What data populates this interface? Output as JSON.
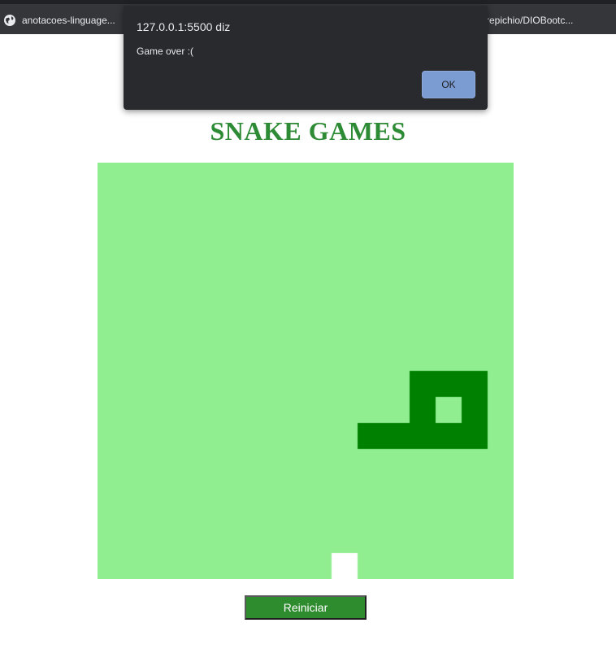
{
  "browser": {
    "bookmarks": [
      {
        "label": "anotacoes-linguage...",
        "icon": "globe-icon"
      },
      {
        "label": "repichio/DIOBootc..."
      }
    ]
  },
  "page": {
    "title": "SNAKE GAMES",
    "restart_label": "Reiniciar"
  },
  "game": {
    "grid_size": 16,
    "board_color": "#90ee90",
    "snake_color": "#008000",
    "food_color": "#ffffff",
    "snake_cells": [
      [
        12,
        8
      ],
      [
        13,
        8
      ],
      [
        14,
        8
      ],
      [
        12,
        9
      ],
      [
        14,
        9
      ],
      [
        10,
        10
      ],
      [
        11,
        10
      ],
      [
        12,
        10
      ],
      [
        13,
        10
      ],
      [
        14,
        10
      ]
    ],
    "food_cell": [
      9,
      15
    ]
  },
  "alert": {
    "origin": "127.0.0.1:5500 diz",
    "message": "Game over :(",
    "ok_label": "OK"
  },
  "colors": {
    "title": "#2e8b35",
    "button": "#2e8b2e",
    "dialog_bg": "#292a2d",
    "ok_button": "#7b9bd3"
  }
}
